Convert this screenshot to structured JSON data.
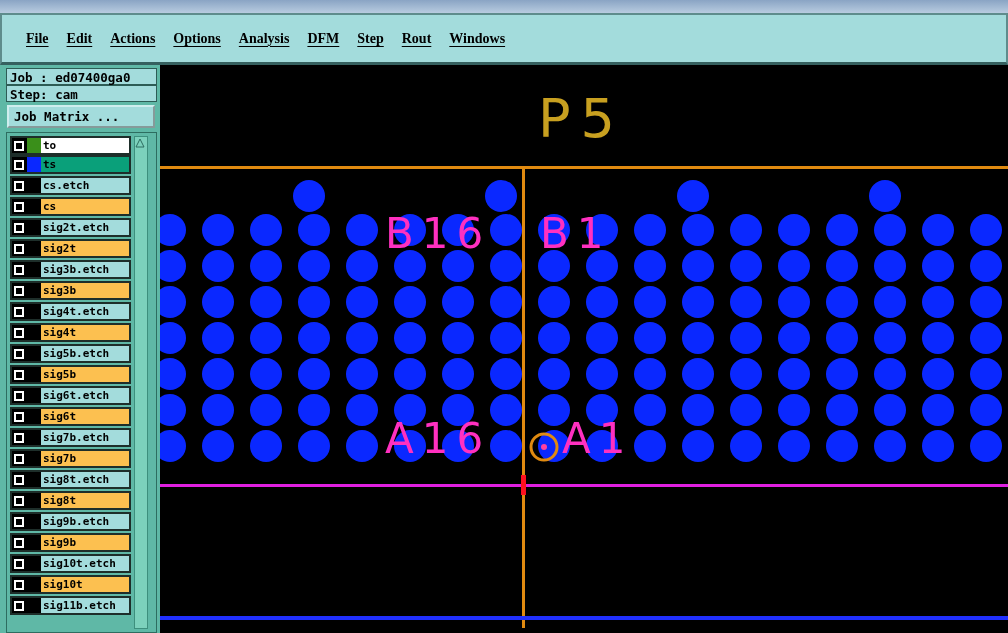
{
  "menu": [
    "File",
    "Edit",
    "Actions",
    "Options",
    "Analysis",
    "DFM",
    "Step",
    "Rout",
    "Windows"
  ],
  "job": {
    "job_label": "Job : ed07400ga0",
    "step_label": "Step: cam",
    "matrix_button": "Job Matrix ..."
  },
  "layers": [
    {
      "name": "to",
      "kind": "active",
      "checked": false,
      "color": "#3a8f1a"
    },
    {
      "name": "ts",
      "kind": "active",
      "checked": false,
      "color": "#0a28ff"
    },
    {
      "name": "cs.etch",
      "kind": "etch",
      "checked": false
    },
    {
      "name": "cs",
      "kind": "signal",
      "checked": false
    },
    {
      "name": "sig2t.etch",
      "kind": "etch",
      "checked": false
    },
    {
      "name": "sig2t",
      "kind": "signal",
      "checked": false
    },
    {
      "name": "sig3b.etch",
      "kind": "etch",
      "checked": false
    },
    {
      "name": "sig3b",
      "kind": "signal",
      "checked": false
    },
    {
      "name": "sig4t.etch",
      "kind": "etch",
      "checked": false
    },
    {
      "name": "sig4t",
      "kind": "signal",
      "checked": false
    },
    {
      "name": "sig5b.etch",
      "kind": "etch",
      "checked": false
    },
    {
      "name": "sig5b",
      "kind": "signal",
      "checked": false
    },
    {
      "name": "sig6t.etch",
      "kind": "etch",
      "checked": false
    },
    {
      "name": "sig6t",
      "kind": "signal",
      "checked": false
    },
    {
      "name": "sig7b.etch",
      "kind": "etch",
      "checked": false
    },
    {
      "name": "sig7b",
      "kind": "signal",
      "checked": false
    },
    {
      "name": "sig8t.etch",
      "kind": "etch",
      "checked": false
    },
    {
      "name": "sig8t",
      "kind": "signal",
      "checked": false
    },
    {
      "name": "sig9b.etch",
      "kind": "etch",
      "checked": false
    },
    {
      "name": "sig9b",
      "kind": "signal",
      "checked": false
    },
    {
      "name": "sig10t.etch",
      "kind": "etch",
      "checked": false
    },
    {
      "name": "sig10t",
      "kind": "signal",
      "checked": false
    },
    {
      "name": "sig11b.etch",
      "kind": "etch",
      "checked": false
    }
  ],
  "canvas": {
    "component_label": "P5",
    "pin_labels": [
      {
        "text": "B16"
      },
      {
        "text": "B1"
      },
      {
        "text": "A16"
      },
      {
        "text": "A1"
      }
    ]
  }
}
